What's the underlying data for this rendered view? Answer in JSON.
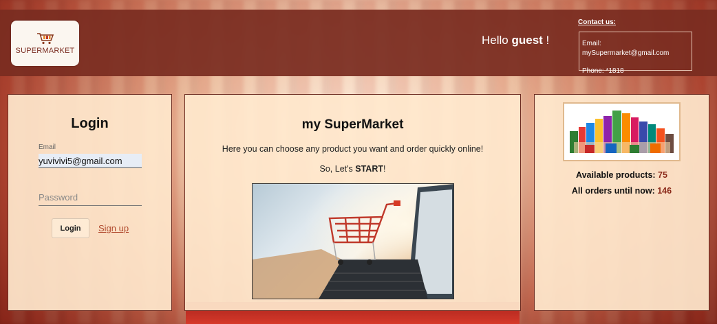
{
  "header": {
    "logo_text": "SUPERMARKET",
    "greeting_prefix": "Hello ",
    "greeting_user": "guest",
    "greeting_suffix": " !",
    "contact_title": "Contact us:",
    "contact_email": "Email: mySupermarket@gmail.com",
    "contact_phone": "Phone: *1818"
  },
  "login": {
    "title": "Login",
    "email_label": "Email",
    "email_value": "yuvivivi5@gmail.com",
    "password_placeholder": "Password",
    "login_button": "Login",
    "signup_link": "Sign up"
  },
  "main": {
    "title": "my SuperMarket",
    "description": "Here you can choose any product you want and order quickly online!",
    "start_prefix": "So, Let's ",
    "start_bold": "START",
    "start_suffix": "!"
  },
  "stats": {
    "available_label": "Available products: ",
    "available_value": "75",
    "orders_label": "All orders until now: ",
    "orders_value": "146"
  },
  "colors": {
    "header_bg": "#7a2c20",
    "panel_bg": "#ffe8cd",
    "accent": "#b14a2e",
    "stat_number": "#8b2a1a"
  }
}
